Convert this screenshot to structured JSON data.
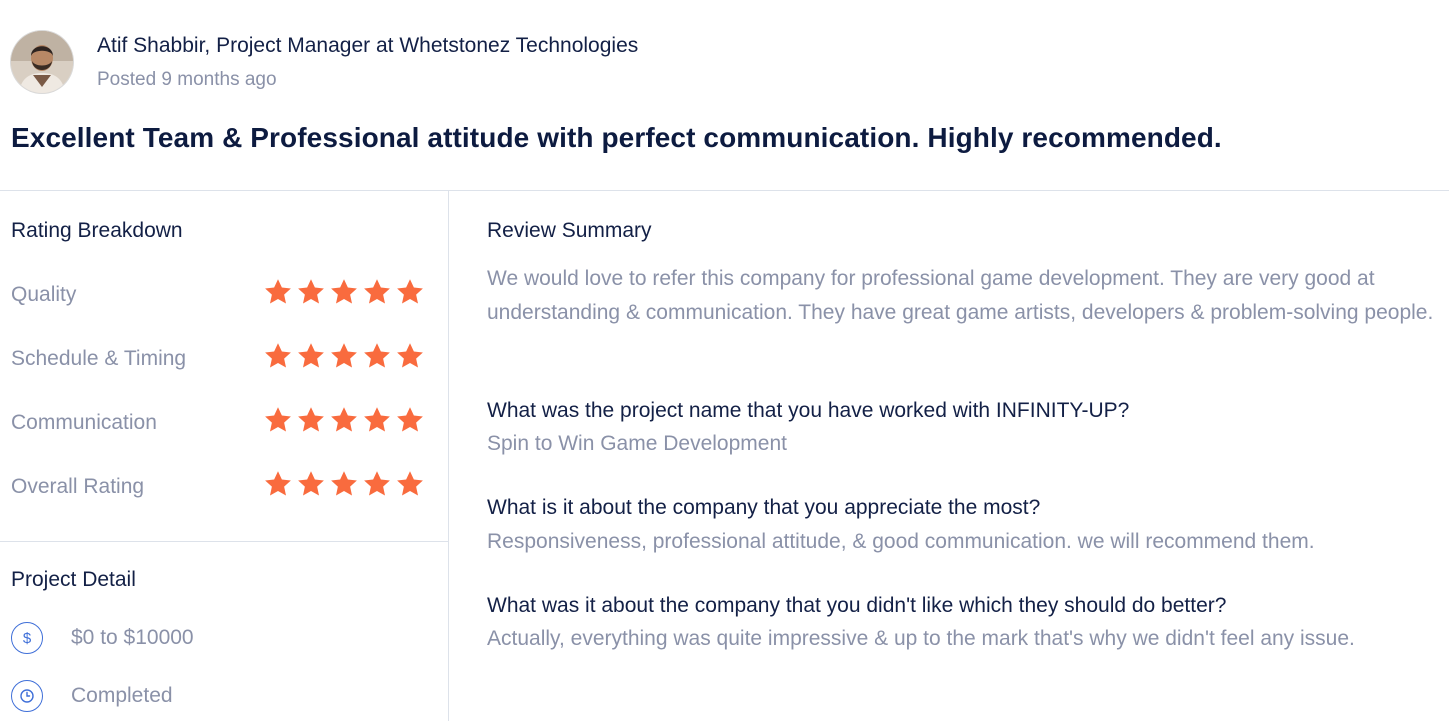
{
  "reviewer": {
    "name_title": "Atif Shabbir, Project Manager at Whetstonez Technologies",
    "posted": "Posted 9 months ago"
  },
  "headline": "Excellent Team & Professional attitude with perfect communication. Highly recommended.",
  "rating_breakdown": {
    "title": "Rating Breakdown",
    "items": [
      {
        "label": "Quality",
        "stars": 5
      },
      {
        "label": "Schedule & Timing",
        "stars": 5
      },
      {
        "label": "Communication",
        "stars": 5
      },
      {
        "label": "Overall Rating",
        "stars": 5
      }
    ],
    "star_color": "#f96b3e"
  },
  "project_detail": {
    "title": "Project Detail",
    "budget": {
      "icon": "dollar-icon",
      "value": "$0 to $10000"
    },
    "status": {
      "icon": "clock-icon",
      "value": "Completed"
    }
  },
  "review_summary": {
    "title": "Review Summary",
    "text": "We would love to refer this company for professional game development. They are very good at understanding & communication. They have great game artists, developers & problem-solving people.",
    "qa": [
      {
        "q": "What was the project name that you have worked with INFINITY-UP?",
        "a": "Spin to Win Game Development"
      },
      {
        "q": "What is it about the company that you appreciate the most?",
        "a": "Responsiveness, professional attitude, & good communication. we will recommend them."
      },
      {
        "q": "What was it about the company that you didn't like which they should do better?",
        "a": "Actually, everything was quite impressive & up to the mark that's why we didn't feel any issue."
      }
    ]
  },
  "colors": {
    "accent": "#3f6fd8",
    "text_dark": "#132046",
    "text_muted": "#8a91a8"
  }
}
